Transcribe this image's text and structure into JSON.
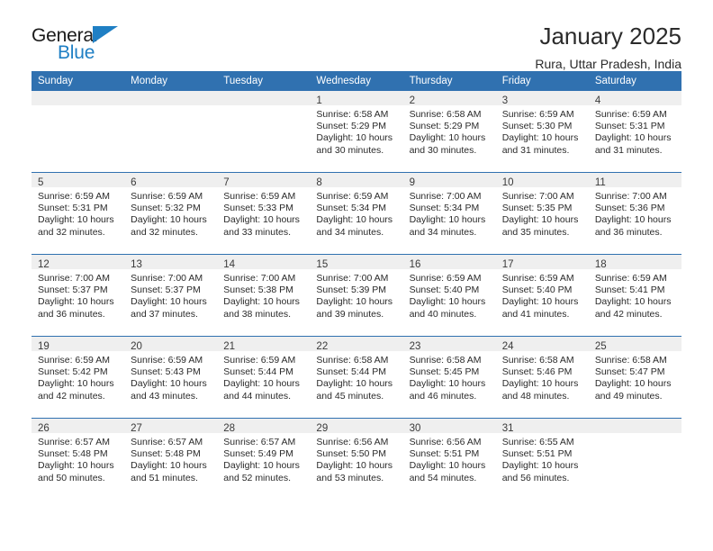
{
  "brand": {
    "name_top": "General",
    "name_bottom": "Blue",
    "accent_color": "#1f7fc4"
  },
  "header": {
    "title": "January 2025",
    "subtitle": "Rura, Uttar Pradesh, India"
  },
  "calendar": {
    "header_bg": "#3071B0",
    "daynum_bg": "#efefef",
    "weekdays": [
      "Sunday",
      "Monday",
      "Tuesday",
      "Wednesday",
      "Thursday",
      "Friday",
      "Saturday"
    ],
    "weeks": [
      [
        {
          "day": "",
          "empty": true
        },
        {
          "day": "",
          "empty": true
        },
        {
          "day": "",
          "empty": true
        },
        {
          "day": "1",
          "sunrise": "Sunrise: 6:58 AM",
          "sunset": "Sunset: 5:29 PM",
          "daylight": "Daylight: 10 hours and 30 minutes."
        },
        {
          "day": "2",
          "sunrise": "Sunrise: 6:58 AM",
          "sunset": "Sunset: 5:29 PM",
          "daylight": "Daylight: 10 hours and 30 minutes."
        },
        {
          "day": "3",
          "sunrise": "Sunrise: 6:59 AM",
          "sunset": "Sunset: 5:30 PM",
          "daylight": "Daylight: 10 hours and 31 minutes."
        },
        {
          "day": "4",
          "sunrise": "Sunrise: 6:59 AM",
          "sunset": "Sunset: 5:31 PM",
          "daylight": "Daylight: 10 hours and 31 minutes."
        }
      ],
      [
        {
          "day": "5",
          "sunrise": "Sunrise: 6:59 AM",
          "sunset": "Sunset: 5:31 PM",
          "daylight": "Daylight: 10 hours and 32 minutes."
        },
        {
          "day": "6",
          "sunrise": "Sunrise: 6:59 AM",
          "sunset": "Sunset: 5:32 PM",
          "daylight": "Daylight: 10 hours and 32 minutes."
        },
        {
          "day": "7",
          "sunrise": "Sunrise: 6:59 AM",
          "sunset": "Sunset: 5:33 PM",
          "daylight": "Daylight: 10 hours and 33 minutes."
        },
        {
          "day": "8",
          "sunrise": "Sunrise: 6:59 AM",
          "sunset": "Sunset: 5:34 PM",
          "daylight": "Daylight: 10 hours and 34 minutes."
        },
        {
          "day": "9",
          "sunrise": "Sunrise: 7:00 AM",
          "sunset": "Sunset: 5:34 PM",
          "daylight": "Daylight: 10 hours and 34 minutes."
        },
        {
          "day": "10",
          "sunrise": "Sunrise: 7:00 AM",
          "sunset": "Sunset: 5:35 PM",
          "daylight": "Daylight: 10 hours and 35 minutes."
        },
        {
          "day": "11",
          "sunrise": "Sunrise: 7:00 AM",
          "sunset": "Sunset: 5:36 PM",
          "daylight": "Daylight: 10 hours and 36 minutes."
        }
      ],
      [
        {
          "day": "12",
          "sunrise": "Sunrise: 7:00 AM",
          "sunset": "Sunset: 5:37 PM",
          "daylight": "Daylight: 10 hours and 36 minutes."
        },
        {
          "day": "13",
          "sunrise": "Sunrise: 7:00 AM",
          "sunset": "Sunset: 5:37 PM",
          "daylight": "Daylight: 10 hours and 37 minutes."
        },
        {
          "day": "14",
          "sunrise": "Sunrise: 7:00 AM",
          "sunset": "Sunset: 5:38 PM",
          "daylight": "Daylight: 10 hours and 38 minutes."
        },
        {
          "day": "15",
          "sunrise": "Sunrise: 7:00 AM",
          "sunset": "Sunset: 5:39 PM",
          "daylight": "Daylight: 10 hours and 39 minutes."
        },
        {
          "day": "16",
          "sunrise": "Sunrise: 6:59 AM",
          "sunset": "Sunset: 5:40 PM",
          "daylight": "Daylight: 10 hours and 40 minutes."
        },
        {
          "day": "17",
          "sunrise": "Sunrise: 6:59 AM",
          "sunset": "Sunset: 5:40 PM",
          "daylight": "Daylight: 10 hours and 41 minutes."
        },
        {
          "day": "18",
          "sunrise": "Sunrise: 6:59 AM",
          "sunset": "Sunset: 5:41 PM",
          "daylight": "Daylight: 10 hours and 42 minutes."
        }
      ],
      [
        {
          "day": "19",
          "sunrise": "Sunrise: 6:59 AM",
          "sunset": "Sunset: 5:42 PM",
          "daylight": "Daylight: 10 hours and 42 minutes."
        },
        {
          "day": "20",
          "sunrise": "Sunrise: 6:59 AM",
          "sunset": "Sunset: 5:43 PM",
          "daylight": "Daylight: 10 hours and 43 minutes."
        },
        {
          "day": "21",
          "sunrise": "Sunrise: 6:59 AM",
          "sunset": "Sunset: 5:44 PM",
          "daylight": "Daylight: 10 hours and 44 minutes."
        },
        {
          "day": "22",
          "sunrise": "Sunrise: 6:58 AM",
          "sunset": "Sunset: 5:44 PM",
          "daylight": "Daylight: 10 hours and 45 minutes."
        },
        {
          "day": "23",
          "sunrise": "Sunrise: 6:58 AM",
          "sunset": "Sunset: 5:45 PM",
          "daylight": "Daylight: 10 hours and 46 minutes."
        },
        {
          "day": "24",
          "sunrise": "Sunrise: 6:58 AM",
          "sunset": "Sunset: 5:46 PM",
          "daylight": "Daylight: 10 hours and 48 minutes."
        },
        {
          "day": "25",
          "sunrise": "Sunrise: 6:58 AM",
          "sunset": "Sunset: 5:47 PM",
          "daylight": "Daylight: 10 hours and 49 minutes."
        }
      ],
      [
        {
          "day": "26",
          "sunrise": "Sunrise: 6:57 AM",
          "sunset": "Sunset: 5:48 PM",
          "daylight": "Daylight: 10 hours and 50 minutes."
        },
        {
          "day": "27",
          "sunrise": "Sunrise: 6:57 AM",
          "sunset": "Sunset: 5:48 PM",
          "daylight": "Daylight: 10 hours and 51 minutes."
        },
        {
          "day": "28",
          "sunrise": "Sunrise: 6:57 AM",
          "sunset": "Sunset: 5:49 PM",
          "daylight": "Daylight: 10 hours and 52 minutes."
        },
        {
          "day": "29",
          "sunrise": "Sunrise: 6:56 AM",
          "sunset": "Sunset: 5:50 PM",
          "daylight": "Daylight: 10 hours and 53 minutes."
        },
        {
          "day": "30",
          "sunrise": "Sunrise: 6:56 AM",
          "sunset": "Sunset: 5:51 PM",
          "daylight": "Daylight: 10 hours and 54 minutes."
        },
        {
          "day": "31",
          "sunrise": "Sunrise: 6:55 AM",
          "sunset": "Sunset: 5:51 PM",
          "daylight": "Daylight: 10 hours and 56 minutes."
        },
        {
          "day": "",
          "empty": true
        }
      ]
    ]
  }
}
